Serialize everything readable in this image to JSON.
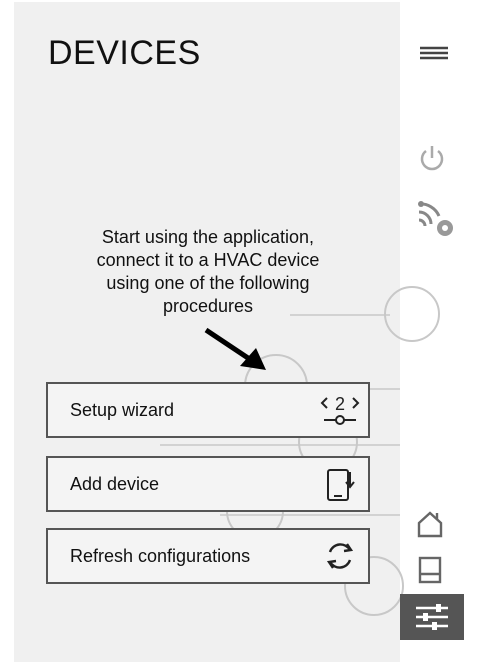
{
  "header": {
    "title": "DEVICES"
  },
  "intro": {
    "text": "Start using the application, connect it to a HVAC device using one of the following procedures"
  },
  "actions": [
    {
      "label": "Setup wizard",
      "icon": "setup-wizard-icon",
      "badge": "2"
    },
    {
      "label": "Add device",
      "icon": "add-device-icon"
    },
    {
      "label": "Refresh configurations",
      "icon": "refresh-icon"
    }
  ],
  "sidebar": {
    "top": [
      "menu-icon",
      "power-icon",
      "wireless-icon"
    ],
    "bottom": [
      "home-icon",
      "device-icon",
      "settings-icon"
    ],
    "active": "settings-icon"
  },
  "colors": {
    "panel": "#f0f0f0",
    "border": "#555555",
    "active_tab": "#555555"
  }
}
